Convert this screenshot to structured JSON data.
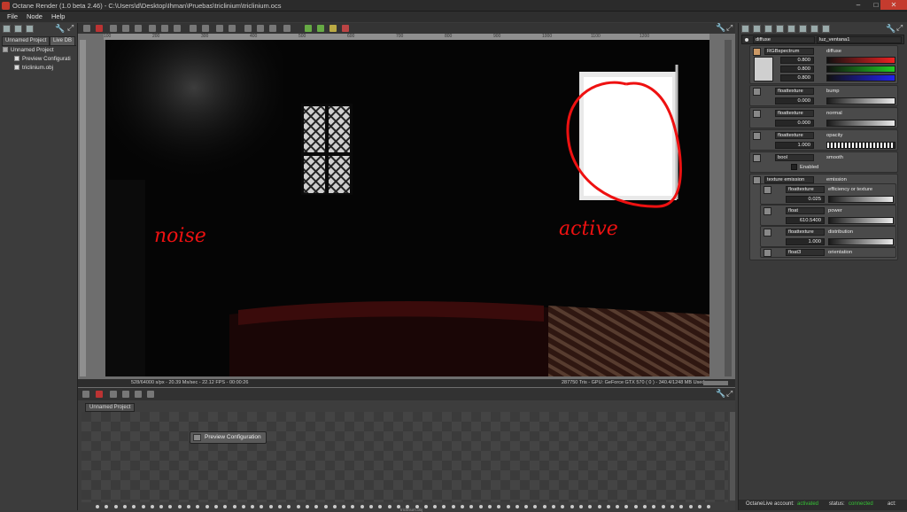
{
  "app": {
    "title": "Octane Render (1.0 beta 2.46) - C:\\Users\\d\\Desktop\\Ihman\\Pruebas\\triclinium\\triclinium.ocs",
    "accent": "#c43b2e"
  },
  "menu": [
    "File",
    "Node",
    "Help"
  ],
  "left_panel": {
    "tabs": [
      "Unnamed Project",
      "Live DB"
    ],
    "tree": [
      "Unnamed Project",
      "Preview Configurati",
      "triclinium.obj"
    ]
  },
  "viewport": {
    "ruler_ticks": [
      "100",
      "200",
      "300",
      "400",
      "500",
      "600",
      "700",
      "800",
      "900",
      "1000",
      "1100",
      "1200"
    ],
    "annotations": {
      "noise": "noise",
      "active": "active"
    },
    "status_left": "528/64000 s/px - 20.39 Ms/sec - 22.12 FPS - 00:00:26",
    "status_right": "287750 Tris - GPU: GeForce GTX 570 ( 0 ) - 340.4/1248 MB Used"
  },
  "graph": {
    "tab": "Unnamed Project",
    "node": "Preview Configuration",
    "timeline_label": "triclinium.obj"
  },
  "inspector": {
    "header_type": "diffuse",
    "header_name": "luz_ventana1",
    "pins": [
      {
        "type": "RGBspectrum",
        "label": "diffuse",
        "values": [
          "0.800",
          "0.800",
          "0.800"
        ]
      },
      {
        "type": "floattexture",
        "label": "bump",
        "value": "0.000"
      },
      {
        "type": "floattexture",
        "label": "normal",
        "value": "0.000"
      },
      {
        "type": "floattexture",
        "label": "opacity",
        "value": "1.000"
      },
      {
        "type": "bool",
        "label": "smooth",
        "check": "Enabled"
      },
      {
        "type": "texture emission",
        "label": "emission"
      }
    ],
    "emission_children": [
      {
        "type": "floattexture",
        "label": "efficiency or texture",
        "value": "0.025"
      },
      {
        "type": "float",
        "label": "power",
        "value": "610.5400"
      },
      {
        "type": "floattexture",
        "label": "distribution",
        "value": "1.000"
      },
      {
        "type": "float3",
        "label": "orientation"
      }
    ],
    "slider_ticks": "0.000.17  0.33  0.50  0.67  0.831.00"
  },
  "status": {
    "account_label": "OctaneLive account:",
    "account_value": "activated",
    "status_label": "status:",
    "status_value": "connected",
    "act_label": "act:",
    "ok_color": "#35c335"
  }
}
